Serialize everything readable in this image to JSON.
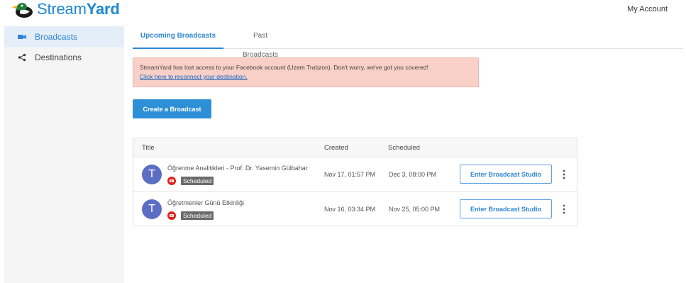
{
  "header": {
    "logo_text_light": "Stream",
    "logo_text_bold": "Yard",
    "my_account": "My Account"
  },
  "sidebar": {
    "items": [
      {
        "label": "Broadcasts",
        "icon": "video-camera-icon",
        "active": true
      },
      {
        "label": "Destinations",
        "icon": "share-icon",
        "active": false
      }
    ]
  },
  "tabs": [
    {
      "label": "Upcoming Broadcasts",
      "active": true
    },
    {
      "label": "Past Broadcasts",
      "active": false
    }
  ],
  "alert": {
    "message": "StreamYard has lost access to your Facebook account (Uzem Trabzon). Don't worry, we've got you covered!",
    "link": "Click here to reconnect your destination."
  },
  "create_button": "Create a Broadcast",
  "table": {
    "columns": [
      "Title",
      "Created",
      "Scheduled"
    ],
    "rows": [
      {
        "avatar": "T",
        "title": "Öğrenme Analitikleri - Prof. Dr. Yasemin Gülbahar",
        "status": "Scheduled",
        "created": "Nov 17, 01:57 PM",
        "scheduled": "Dec 3, 08:00 PM",
        "action": "Enter Broadcast Studio"
      },
      {
        "avatar": "T",
        "title": "Öğretmenler Günü Etkinliği",
        "status": "Scheduled",
        "created": "Nov 16, 03:34 PM",
        "scheduled": "Nov 25, 05:00 PM",
        "action": "Enter Broadcast Studio"
      }
    ]
  },
  "colors": {
    "brand": "#1e88d2",
    "accent": "#2d8fd6",
    "alert_bg": "#f8d0c8",
    "avatar": "#5b6ec4",
    "youtube": "#e62117"
  }
}
